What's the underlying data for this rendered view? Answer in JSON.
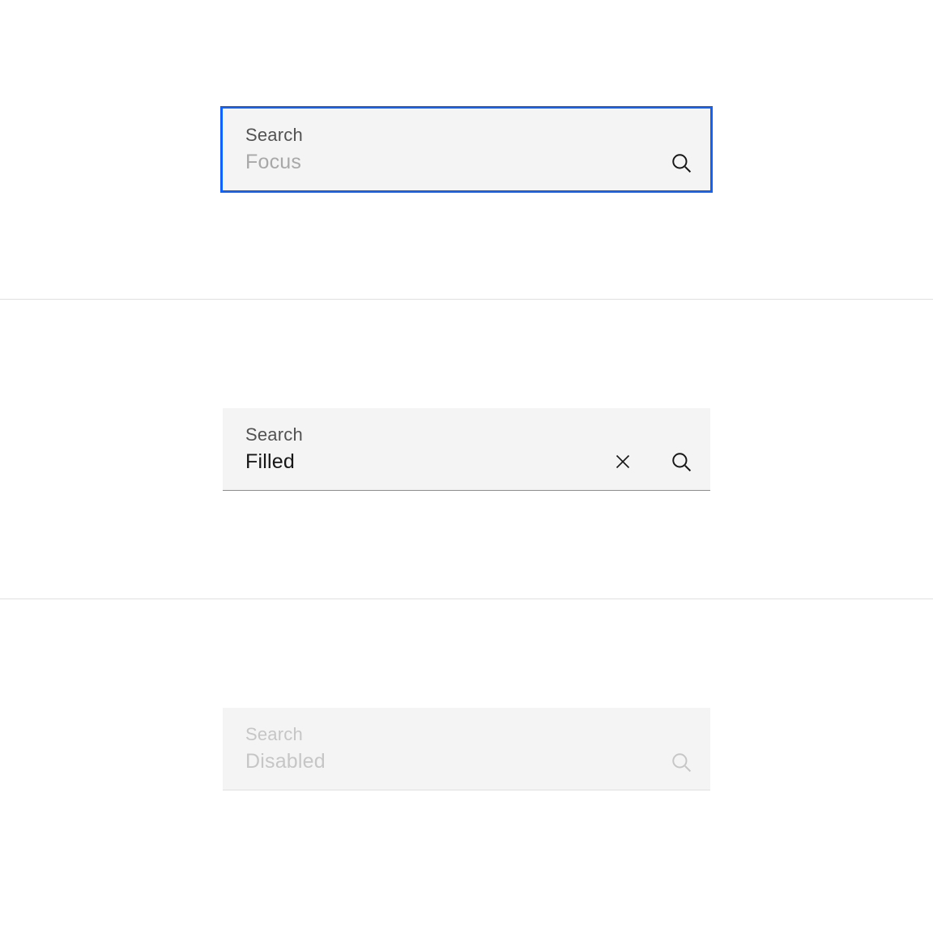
{
  "states": {
    "focus": {
      "label": "Search",
      "placeholder": "Focus",
      "value": ""
    },
    "filled": {
      "label": "Search",
      "placeholder": "",
      "value": "Filled"
    },
    "disabled": {
      "label": "Search",
      "placeholder": "Disabled",
      "value": ""
    }
  },
  "colors": {
    "focus_outline": "#0f62fe",
    "field_bg": "#f4f4f4",
    "label": "#525252",
    "placeholder": "#a8a8a8",
    "text": "#161616",
    "disabled": "#c6c6c6",
    "divider": "#e0e0e0",
    "bottom_border": "#8d8d8d"
  }
}
